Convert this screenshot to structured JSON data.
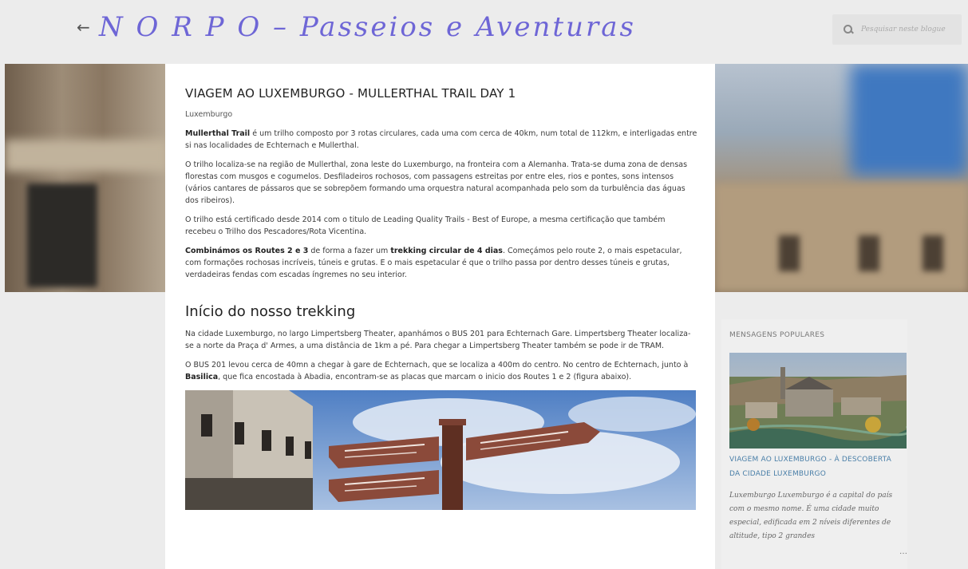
{
  "header": {
    "back_symbol": "←",
    "blog_title": "N O R P O – Passeios e Aventuras",
    "search_placeholder": "Pesquisar neste blogue"
  },
  "post": {
    "title": "VIAGEM AO LUXEMBURGO - MULLERTHAL TRAIL DAY 1",
    "label": "Luxemburgo",
    "p1_bold": "Mullerthal Trail",
    "p1_rest": " é um trilho composto por 3 rotas circulares, cada uma com cerca de 40km, num total de 112km, e interligadas entre si nas localidades de Echternach e Mullerthal.",
    "p2": "O trilho localiza-se na região de Mullerthal, zona leste do Luxemburgo, na fronteira com a Alemanha. Trata-se duma zona de densas florestas com musgos e cogumelos. Desfiladeiros rochosos, com passagens estreitas por entre eles, rios e pontes, sons intensos (vários cantares de pássaros que se sobrepõem formando uma orquestra natural acompanhada pelo som da turbulência das águas dos ribeiros).",
    "p3": "O trilho está certificado desde 2014  com o titulo de Leading Quality Trails - Best of Europe, a mesma certificação que também recebeu o Trilho dos Pescadores/Rota Vicentina.",
    "p4_bold1": "Combinámos os Routes 2 e 3",
    "p4_mid": " de forma a fazer um ",
    "p4_bold2": "trekking circular de 4 dias",
    "p4_rest": ". Começámos pelo route 2, o mais espetacular, com formações rochosas incríveis, túneis e grutas. E o mais espetacular é que o trilho passa por dentro desses túneis e grutas, verdadeiras fendas com escadas íngremes no seu interior.",
    "section_heading": "Início do nosso trekking",
    "p5": "Na cidade Luxemburgo, no largo Limpertsberg Theater, apanhámos o BUS 201 para Echternach Gare. Limpertsberg Theater localiza-se a norte da Praça d' Armes, a uma distância de 1km a pé. Para chegar a Limpertsberg Theater também se pode ir de TRAM.",
    "p6_start": "O BUS 201 levou cerca de 40mn a chegar à gare de Echternach, que se localiza a 400m do centro. No centro de Echternach, junto à ",
    "p6_bold": "Basilica",
    "p6_rest": ", que fica encostada à Abadia, encontram-se as placas que marcam o inicio dos Routes 1 e 2 (figura abaixo)."
  },
  "sidebar": {
    "heading": "MENSAGENS POPULARES",
    "popular_title": "VIAGEM AO LUXEMBURGO - À DESCOBERTA DA CIDADE LUXEMBURGO",
    "popular_snippet": "Luxemburgo Luxemburgo é a capital do país com o mesmo nome.  É uma cidade muito especial, edificada em 2 níveis diferentes de altitude, tipo 2 grandes",
    "ellipsis": "…"
  },
  "colors": {
    "title_accent": "#6e66d6",
    "link_blue": "#4a7fa8",
    "page_bg": "#ececec"
  }
}
